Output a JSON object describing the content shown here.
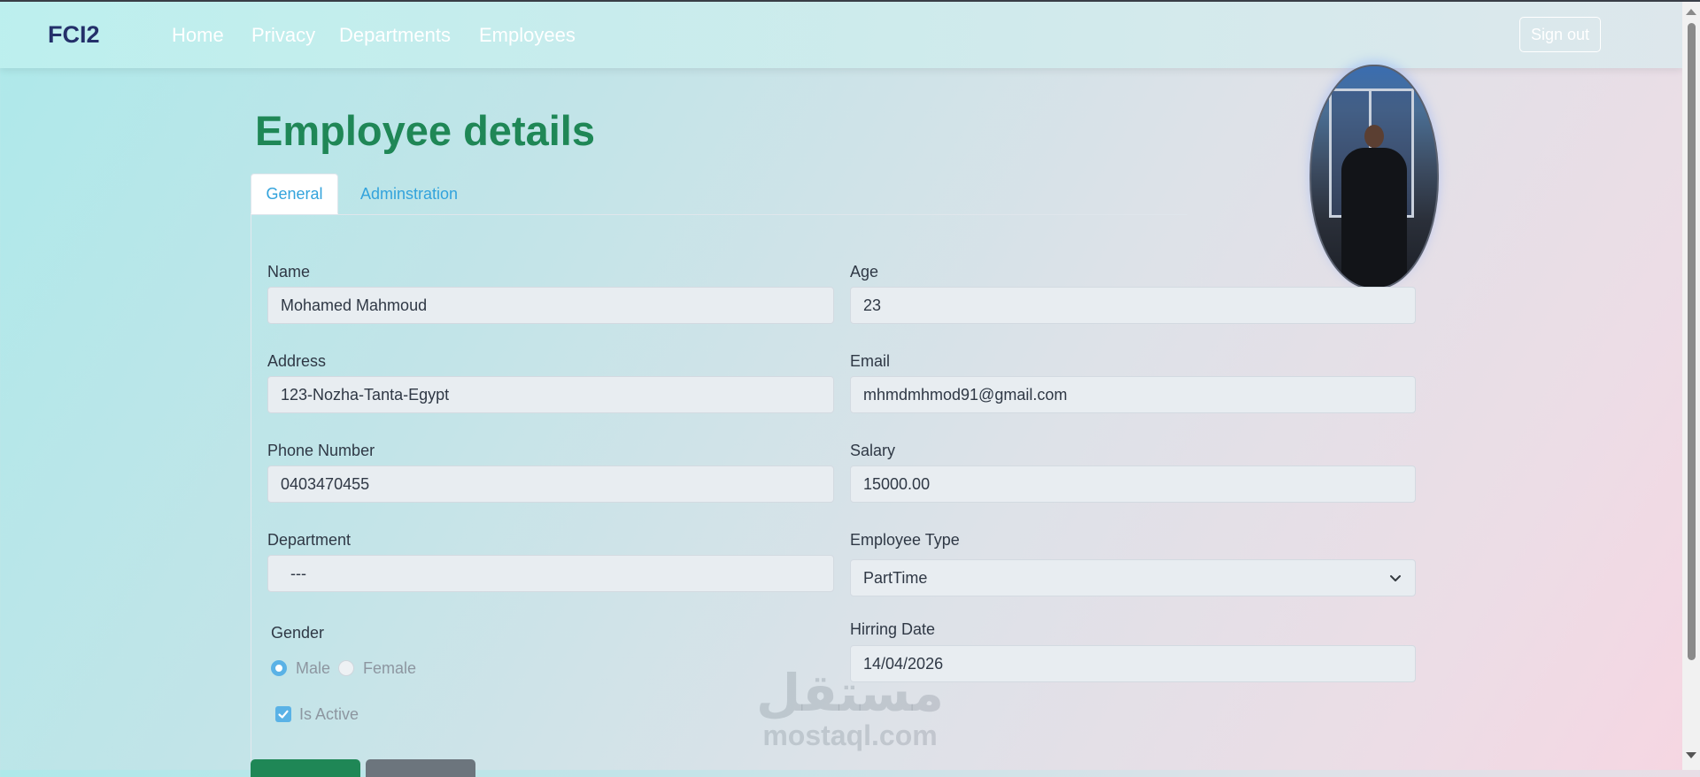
{
  "navbar": {
    "brand": "FCI2",
    "links": [
      "Home",
      "Privacy",
      "Departments",
      "Employees"
    ],
    "signout_label": "Sign out"
  },
  "page": {
    "title": "Employee details",
    "tabs": [
      {
        "label": "General",
        "active": true
      },
      {
        "label": "Adminstration",
        "active": false
      }
    ]
  },
  "form": {
    "name": {
      "label": "Name",
      "value": "Mohamed Mahmoud"
    },
    "age": {
      "label": "Age",
      "value": "23"
    },
    "address": {
      "label": "Address",
      "value": "123-Nozha-Tanta-Egypt"
    },
    "email": {
      "label": "Email",
      "value": "mhmdmhmod91@gmail.com"
    },
    "phone": {
      "label": "Phone Number",
      "value": "0403470455"
    },
    "salary": {
      "label": "Salary",
      "value": "15000.00"
    },
    "department": {
      "label": "Department",
      "value": "---"
    },
    "employee_type": {
      "label": "Employee Type",
      "value": "PartTime"
    },
    "gender": {
      "label": "Gender",
      "options": [
        "Male",
        "Female"
      ],
      "selected": "Male"
    },
    "hiring_date": {
      "label": "Hirring Date",
      "value": "14/04/2026"
    },
    "is_active": {
      "label": "Is Active",
      "checked": true
    }
  },
  "watermark": {
    "arabic": "مستقل",
    "latin": "mostaql.com"
  },
  "colors": {
    "brand": "#24306a",
    "title": "#1f8756",
    "tab_link": "#33a3dc",
    "checkbox": "#5ab2e6",
    "save_button": "#1f8756",
    "back_button": "#6c757d"
  },
  "icons": {
    "select_chevron": "chevron-down-icon",
    "checkbox_check": "check-icon",
    "profile_photo": "avatar"
  }
}
